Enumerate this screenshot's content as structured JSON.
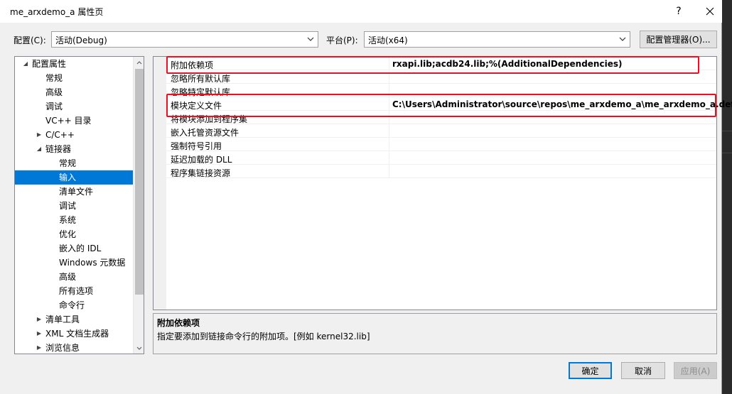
{
  "window": {
    "title": "me_arxdemo_a 属性页",
    "help_label": "?"
  },
  "toolbar": {
    "config_label": "配置(C):",
    "config_value": "活动(Debug)",
    "platform_label": "平台(P):",
    "platform_value": "活动(x64)",
    "config_manager_label": "配置管理器(O)..."
  },
  "tree": {
    "root": "配置属性",
    "items": [
      "常规",
      "高级",
      "调试",
      "VC++ 目录",
      "C/C++",
      "链接器",
      "常规",
      "输入",
      "清单文件",
      "调试",
      "系统",
      "优化",
      "嵌入的 IDL",
      "Windows 元数据",
      "高级",
      "所有选项",
      "命令行",
      "清单工具",
      "XML 文档生成器",
      "浏览信息"
    ],
    "expanders": {
      "collapsed": "▶",
      "expanded": "◢"
    },
    "selected": "输入"
  },
  "grid": {
    "rows": [
      {
        "name": "附加依赖项",
        "value": "rxapi.lib;acdb24.lib;%(AdditionalDependencies)"
      },
      {
        "name": "忽略所有默认库",
        "value": ""
      },
      {
        "name": "忽略特定默认库",
        "value": ""
      },
      {
        "name": "模块定义文件",
        "value": "C:\\Users\\Administrator\\source\\repos\\me_arxdemo_a\\me_arxdemo_a.def"
      },
      {
        "name": "将模块添加到程序集",
        "value": ""
      },
      {
        "name": "嵌入托管资源文件",
        "value": ""
      },
      {
        "name": "强制符号引用",
        "value": ""
      },
      {
        "name": "延迟加载的 DLL",
        "value": ""
      },
      {
        "name": "程序集链接资源",
        "value": ""
      }
    ]
  },
  "description": {
    "title": "附加依赖项",
    "text": "指定要添加到链接命令行的附加项。[例如 kernel32.lib]"
  },
  "buttons": {
    "ok": "确定",
    "cancel": "取消",
    "apply": "应用(A)"
  },
  "colors": {
    "selection": "#0078d7",
    "highlight_box": "#e81123"
  }
}
